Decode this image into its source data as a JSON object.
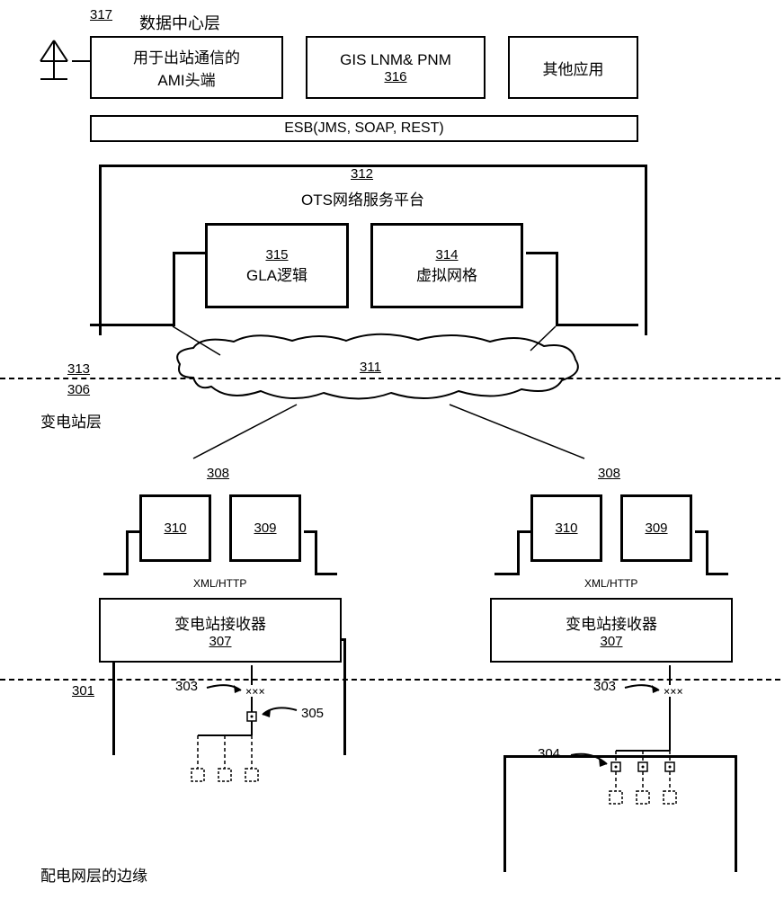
{
  "refs": {
    "topFig": "317",
    "dataCenterLayer": "数据中心层",
    "amiBox": "用于出站通信的\nAMI头端",
    "gisBoxLine1": "GIS LNM& PNM",
    "gisRef": "316",
    "otherApps": "其他应用",
    "esb": "ESB(JMS, SOAP, REST)",
    "otsRef": "312",
    "otsLabel": "OTS网络服务平台",
    "glaRef": "315",
    "glaLabel": "GLA逻辑",
    "vgRef": "314",
    "vgLabel": "虚拟网格",
    "leftDivTop": "313",
    "leftDivBottom": "306",
    "cloudRef": "311",
    "substationLayer": "变电站层",
    "subURef": "308",
    "subInnerLeft": "310",
    "subInnerRight": "309",
    "xmlHttp": "XML/HTTP",
    "receiverLabel": "变电站接收器",
    "receiverRef": "307",
    "bottomDiv": "301",
    "arrow303": "303",
    "arrow305": "305",
    "arrow304": "304",
    "distLayer": "配电网层的边缘"
  }
}
